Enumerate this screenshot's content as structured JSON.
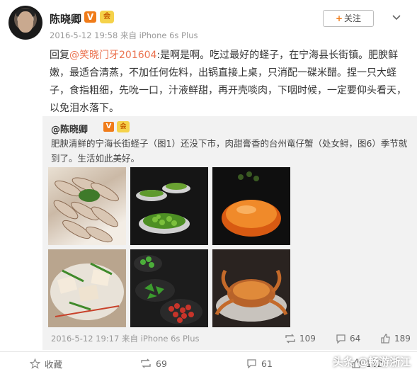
{
  "post": {
    "author": "陈晓卿",
    "vip_badge": "V",
    "member_badge": "会",
    "meta": "2016-5-12 19:58 来自 iPhone 6s Plus",
    "follow_label": "关注",
    "follow_plus": "+",
    "dropdown_icon": "chevron-down-icon",
    "text_prefix": "回复",
    "mention": "@笑晓门牙201604",
    "text_body": ":是啊是啊。吃过最好的蛏子，在宁海县长街镇。肥腴鲜嫩，最适合清蒸，不加任何佐料，出锅直接上桌，只消配一碟米醋。捏一只大蛏子，食指粗细，先吮一口，汁液鲜甜，再开壳啖肉，下咽时候，一定要仰头看天，以免泪水落下。"
  },
  "quoted": {
    "author": "@陈晓卿",
    "vip_badge": "V",
    "member_badge": "会",
    "text": "肥腴清鲜的宁海长街蛏子（图1）还没下市，肉甜膏香的台州竜仔蟹（处女鲟，图6）季节就到了。生活如此美好。",
    "time": "2016-5-12 19:17 来自 iPhone 6s Plus",
    "reposts": "109",
    "comments": "64",
    "likes": "189"
  },
  "actions": {
    "favorite": "收藏",
    "repost": "69",
    "comment": "61",
    "like": "112"
  },
  "watermark": "头条 @畅游浙江",
  "colors": {
    "accent": "#f07c1a",
    "mention": "#eb7350",
    "quote_bg": "#f2f2f2"
  }
}
